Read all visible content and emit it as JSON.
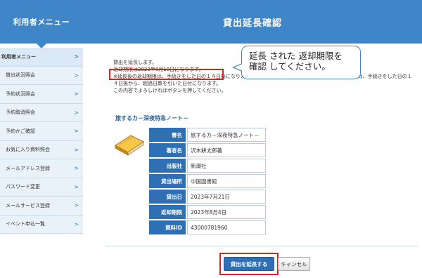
{
  "sidebar": {
    "header": "利用者メニュー",
    "items": [
      {
        "label": "利用者メニュー"
      },
      {
        "label": "貸出状況照会"
      },
      {
        "label": "予約状況照会"
      },
      {
        "label": "予約取消照会"
      },
      {
        "label": "予約かご確認"
      },
      {
        "label": "お気に入り資料照会"
      },
      {
        "label": "メールアドレス登録"
      },
      {
        "label": "パスワード変更"
      },
      {
        "label": "メールサービス登録"
      },
      {
        "label": "イベント申込一覧"
      }
    ]
  },
  "page": {
    "title": "貸出延長確認",
    "intro": "貸出を延長します。",
    "due_line": "返却期限は2023年8月18日になります。",
    "note": "※延長後の返却期限は、手続きをした日の１４日後になります。ただし、返却期限を超過している資料については、手続きをした日の１４日後から、超過日数を引いた日付になります。",
    "confirm": "この内容でよろしければボタンを押してください。"
  },
  "callout": {
    "line1": "延長 された 返却期限を",
    "line2": "確認 してください。"
  },
  "book": {
    "heading": "旅するカ－深夜特急ノート－",
    "rows": [
      {
        "label": "書名",
        "value": "旅するカ－深夜特急ノート－"
      },
      {
        "label": "著者名",
        "value": "沢木耕太郎著"
      },
      {
        "label": "出版社",
        "value": "新潮社"
      },
      {
        "label": "貸出場所",
        "value": "中国図書館"
      },
      {
        "label": "貸出日",
        "value": "2023年7月21日"
      },
      {
        "label": "返却期限",
        "value": "2023年8月4日"
      },
      {
        "label": "資料ID",
        "value": "43000781960"
      }
    ]
  },
  "buttons": {
    "extend": "貸出を延長する",
    "cancel": "キャンセル"
  },
  "colors": {
    "header_blue": "#3f86c8",
    "button_blue": "#2f6fb4",
    "highlight_red": "#e02020"
  }
}
